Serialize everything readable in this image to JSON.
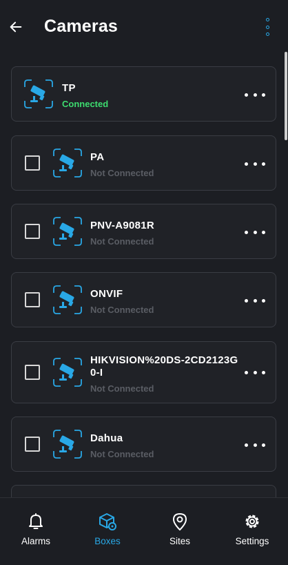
{
  "header": {
    "title": "Cameras",
    "back_icon": "arrow-left-icon",
    "menu_icon": "more-vertical-icon"
  },
  "colors": {
    "background": "#1c1e23",
    "card": "#202227",
    "accent": "#29a8e6",
    "connected": "#3ddc6f",
    "not_connected": "#5a5d64"
  },
  "cameras": [
    {
      "name": "TP",
      "status": "Connected",
      "connected": true,
      "has_checkbox": false
    },
    {
      "name": "PA",
      "status": "Not Connected",
      "connected": false,
      "has_checkbox": true
    },
    {
      "name": "PNV-A9081R",
      "status": "Not Connected",
      "connected": false,
      "has_checkbox": true
    },
    {
      "name": "ONVIF",
      "status": "Not Connected",
      "connected": false,
      "has_checkbox": true
    },
    {
      "name_line1": "HIKVISION%20DS-2CD2123G",
      "name_line2": "0-I",
      "status": "Not Connected",
      "connected": false,
      "has_checkbox": true
    },
    {
      "name": "Dahua",
      "status": "Not Connected",
      "connected": false,
      "has_checkbox": true
    }
  ],
  "nav": {
    "active": "Boxes",
    "items": [
      {
        "label": "Alarms",
        "icon": "bell-icon"
      },
      {
        "label": "Boxes",
        "icon": "box-icon"
      },
      {
        "label": "Sites",
        "icon": "map-pin-icon"
      },
      {
        "label": "Settings",
        "icon": "gear-icon"
      }
    ]
  }
}
